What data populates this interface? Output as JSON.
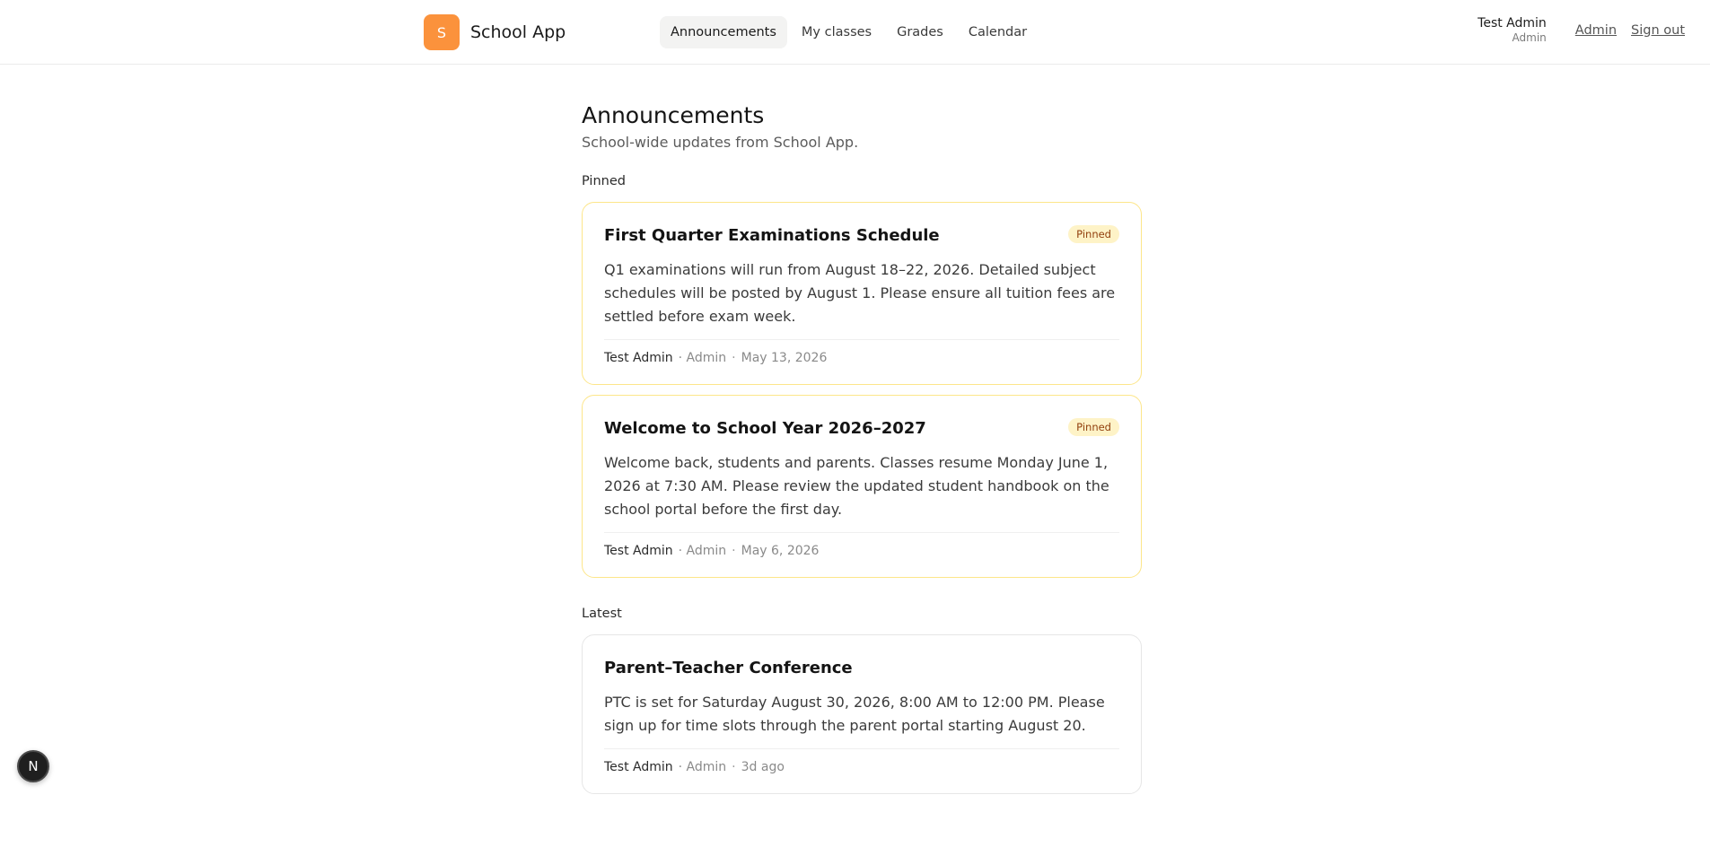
{
  "header": {
    "brand_initial": "S",
    "brand_name": "School App",
    "nav": [
      {
        "label": "Announcements",
        "active": true
      },
      {
        "label": "My classes",
        "active": false
      },
      {
        "label": "Grades",
        "active": false
      },
      {
        "label": "Calendar",
        "active": false
      }
    ],
    "user_name": "Test Admin",
    "user_role": "Admin",
    "admin_link": "Admin",
    "signout_link": "Sign out"
  },
  "main": {
    "title": "Announcements",
    "subtitle": "School-wide updates from School App.",
    "pinned_label": "Pinned",
    "latest_label": "Latest",
    "pinned": [
      {
        "title": "First Quarter Examinations Schedule",
        "badge": "Pinned",
        "body": "Q1 examinations will run from August 18–22, 2026. Detailed subject schedules will be posted by August 1. Please ensure all tuition fees are settled before exam week.",
        "author": "Test Admin",
        "role": "· Admin",
        "date": "May 13, 2026"
      },
      {
        "title": "Welcome to School Year 2026–2027",
        "badge": "Pinned",
        "body": "Welcome back, students and parents. Classes resume Monday June 1, 2026 at 7:30 AM. Please review the updated student handbook on the school portal before the first day.",
        "author": "Test Admin",
        "role": "· Admin",
        "date": "May 6, 2026"
      }
    ],
    "latest": [
      {
        "title": "Parent–Teacher Conference",
        "body": "PTC is set for Saturday August 30, 2026, 8:00 AM to 12:00 PM. Please sign up for time slots through the parent portal starting August 20.",
        "author": "Test Admin",
        "role": "· Admin",
        "date": "3d ago"
      }
    ],
    "footer_separator": "·"
  },
  "dev_badge": "N",
  "colors": {
    "brand": "#fb923c",
    "pinned_border": "#fde68a",
    "pinned_badge_bg": "#fef3c7",
    "pinned_badge_text": "#92400e"
  }
}
